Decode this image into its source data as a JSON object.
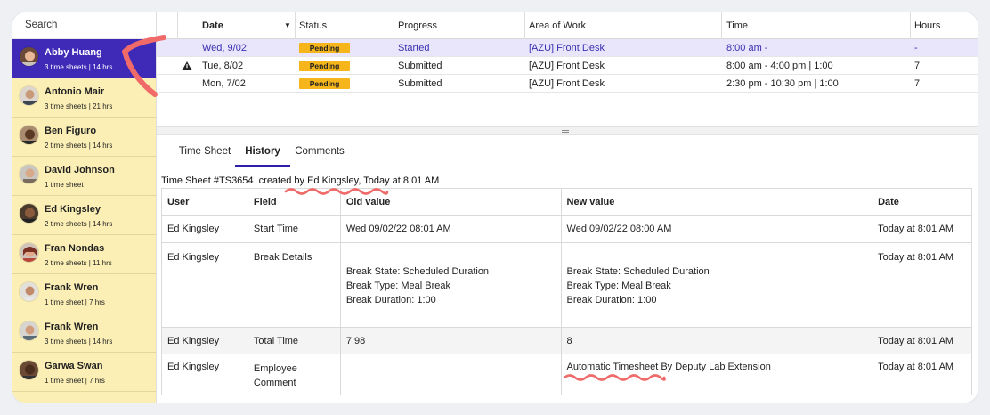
{
  "sidebar": {
    "search_label": "Search",
    "employees": [
      {
        "name": "Abby Huang",
        "meta": "3 time sheets | 14 hrs",
        "active": true
      },
      {
        "name": "Antonio Mair",
        "meta": "3 time sheets | 21 hrs"
      },
      {
        "name": "Ben Figuro",
        "meta": "2 time sheets | 14 hrs"
      },
      {
        "name": "David Johnson",
        "meta": "1 time sheet"
      },
      {
        "name": "Ed Kingsley",
        "meta": "2 time sheets | 14 hrs"
      },
      {
        "name": "Fran Nondas",
        "meta": "2 time sheets | 11 hrs"
      },
      {
        "name": "Frank Wren",
        "meta": "1 time sheet | 7 hrs"
      },
      {
        "name": "Frank Wren",
        "meta": "3 time sheets | 14 hrs"
      },
      {
        "name": "Garwa Swan",
        "meta": "1 time sheet | 7 hrs"
      }
    ]
  },
  "timesheets": {
    "headers": {
      "date": "Date",
      "status": "Status",
      "progress": "Progress",
      "area": "Area of Work",
      "time": "Time",
      "hours": "Hours"
    },
    "rows": [
      {
        "warning": false,
        "date": "Wed, 9/02",
        "status": "Pending",
        "progress": "Started",
        "area": "[AZU] Front Desk",
        "time": "8:00 am -",
        "hours": "-"
      },
      {
        "warning": true,
        "date": "Tue, 8/02",
        "status": "Pending",
        "progress": "Submitted",
        "area": "[AZU] Front Desk",
        "time": "8:00 am - 4:00 pm | 1:00",
        "hours": "7"
      },
      {
        "warning": false,
        "date": "Mon, 7/02",
        "status": "Pending",
        "progress": "Submitted",
        "area": "[AZU] Front Desk",
        "time": "2:30 pm - 10:30 pm | 1:00",
        "hours": "7"
      }
    ]
  },
  "tabs": [
    "Time Sheet",
    "History",
    "Comments"
  ],
  "history": {
    "title_line": "Time Sheet #TS3654  created by Ed Kingsley, Today at 8:01 AM",
    "headers": {
      "user": "User",
      "field": "Field",
      "old": "Old value",
      "new": "New value",
      "date": "Date"
    },
    "rows": [
      {
        "user": "Ed Kingsley",
        "field": "Start Time",
        "old": "Wed 09/02/22 08:01 AM",
        "new": "Wed 09/02/22 08:00 AM",
        "date": "Today at 8:01 AM"
      },
      {
        "user": "Ed Kingsley",
        "field": "Break Details",
        "old_lines": [
          "Break State: Scheduled Duration",
          "Break Type: Meal Break",
          "Break Duration: 1:00"
        ],
        "new_lines": [
          "Break State: Scheduled Duration",
          "Break Type: Meal Break",
          "Break Duration: 1:00"
        ],
        "date": "Today at 8:01 AM"
      },
      {
        "user": "Ed Kingsley",
        "field": "Total Time",
        "old": "7.98",
        "new": "8",
        "date": "Today at 8:01 AM"
      },
      {
        "user": "Ed Kingsley",
        "field_lines": [
          "Employee",
          "Comment"
        ],
        "old": "",
        "new": "Automatic Timesheet By Deputy Lab Extension",
        "date": "Today at 8:01 AM"
      }
    ]
  },
  "colors": {
    "accent": "#3f2ab8",
    "badge": "#f5b51b",
    "annotation": "#f06a6a",
    "sidebar_row": "#fbefb5"
  }
}
